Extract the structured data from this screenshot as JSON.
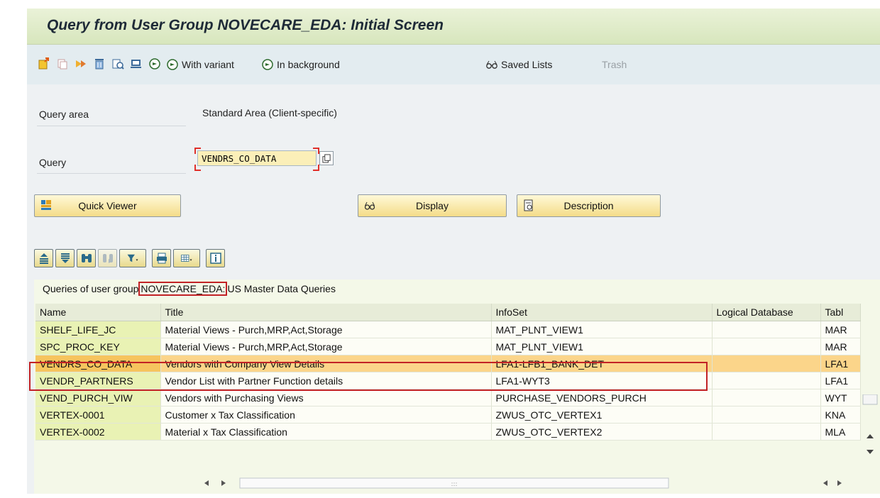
{
  "title": "Query from User Group NOVECARE_EDA: Initial Screen",
  "toolbar": {
    "with_variant": "With variant",
    "in_background": "In background",
    "saved_lists": "Saved Lists",
    "trash": "Trash"
  },
  "form": {
    "query_area_label": "Query area",
    "query_area_value": "Standard Area (Client-specific)",
    "query_label": "Query",
    "query_value": "VENDRS_CO_DATA"
  },
  "buttons": {
    "quick_viewer": "Quick Viewer",
    "display": "Display",
    "description": "Description"
  },
  "grid": {
    "caption_prefix": "Queries of user group",
    "caption_group": "NOVECARE_EDA:",
    "caption_suffix": "US Master Data Queries",
    "columns": [
      "Name",
      "Title",
      "InfoSet",
      "Logical Database",
      "Tabl"
    ],
    "rows": [
      {
        "name": "SHELF_LIFE_JC",
        "title": "Material Views - Purch,MRP,Act,Storage",
        "infoset": "MAT_PLNT_VIEW1",
        "ldb": "",
        "tab": "MAR"
      },
      {
        "name": "SPC_PROC_KEY",
        "title": "Material Views - Purch,MRP,Act,Storage",
        "infoset": "MAT_PLNT_VIEW1",
        "ldb": "",
        "tab": "MAR"
      },
      {
        "name": "VENDRS_CO_DATA",
        "title": "Vendors with Company View Details",
        "infoset": "LFA1-LFB1_BANK_DET",
        "ldb": "",
        "tab": "LFA1"
      },
      {
        "name": "VENDR_PARTNERS",
        "title": "Vendor List with Partner Function details",
        "infoset": "LFA1-WYT3",
        "ldb": "",
        "tab": "LFA1"
      },
      {
        "name": "VEND_PURCH_VIW",
        "title": "Vendors with Purchasing Views",
        "infoset": "PURCHASE_VENDORS_PURCH",
        "ldb": "",
        "tab": "WYT"
      },
      {
        "name": "VERTEX-0001",
        "title": "Customer x Tax Classification",
        "infoset": "ZWUS_OTC_VERTEX1",
        "ldb": "",
        "tab": "KNA"
      },
      {
        "name": "VERTEX-0002",
        "title": "Material x Tax Classification",
        "infoset": "ZWUS_OTC_VERTEX2",
        "ldb": "",
        "tab": "MLA"
      }
    ],
    "selected_row": 2,
    "hscroll_grip": ":::"
  }
}
